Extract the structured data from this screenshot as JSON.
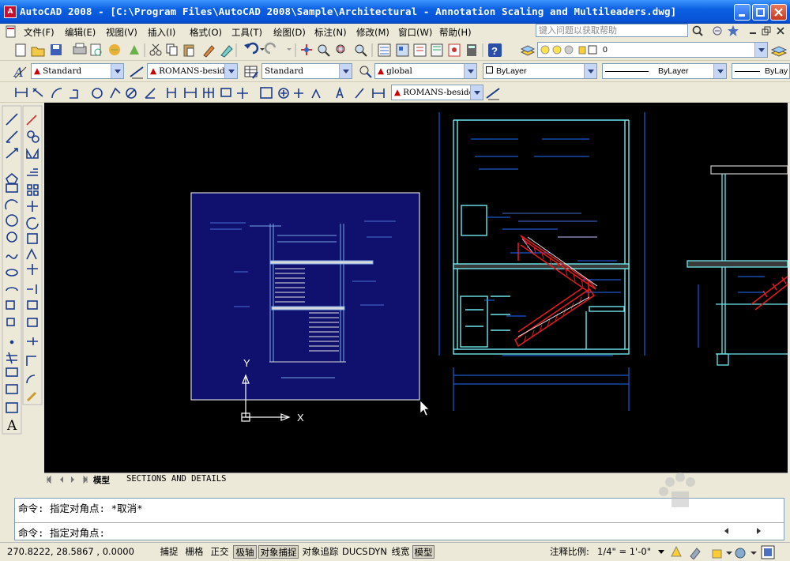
{
  "window": {
    "title": "AutoCAD 2008 - [C:\\Program Files\\AutoCAD 2008\\Sample\\Architectural - Annotation Scaling and Multileaders.dwg]"
  },
  "menu": {
    "items": [
      "文件(F)",
      "编辑(E)",
      "视图(V)",
      "插入(I)",
      "格式(O)",
      "工具(T)",
      "绘图(D)",
      "标注(N)",
      "修改(M)",
      "窗口(W)",
      "帮助(H)"
    ]
  },
  "help": {
    "placeholder": "键入问题以获取帮助"
  },
  "layer": {
    "current": "0"
  },
  "styles": {
    "text_style": "Standard",
    "text_style_combo": "ROMANS-beside",
    "dim_style": "Standard",
    "table_style": "global",
    "mleader_style": "ROMANS-beside"
  },
  "properties": {
    "color": "ByLayer",
    "linetype": "ByLayer",
    "lineweight": "ByLay"
  },
  "drawing": {
    "ucs_x": "X",
    "ucs_y": "Y"
  },
  "tabs": {
    "model": "模型",
    "layout": "SECTIONS AND DETAILS"
  },
  "command": {
    "line1": "命令: 指定对角点: *取消*",
    "line2": "命令: 指定对角点:"
  },
  "status": {
    "coords": "270.8222, 28.5867 , 0.0000",
    "toggles": [
      {
        "label": "捕捉",
        "on": false
      },
      {
        "label": "栅格",
        "on": false
      },
      {
        "label": "正交",
        "on": false
      },
      {
        "label": "极轴",
        "on": true
      },
      {
        "label": "对象捕捉",
        "on": true
      },
      {
        "label": "对象追踪",
        "on": false
      },
      {
        "label": "DUCS",
        "on": false
      },
      {
        "label": "DYN",
        "on": false
      },
      {
        "label": "线宽",
        "on": false
      },
      {
        "label": "模型",
        "on": true
      }
    ],
    "annotation_scale_label": "注释比例:",
    "annotation_scale_value": "1/4\" = 1'-0\""
  },
  "colors": {
    "title_bar": "#0752d6",
    "canvas": "#000000",
    "selection": "#10106e",
    "toolbar": "#ece9d8",
    "section_lines": "#1e90ff",
    "stair_red": "#e01b1b"
  }
}
